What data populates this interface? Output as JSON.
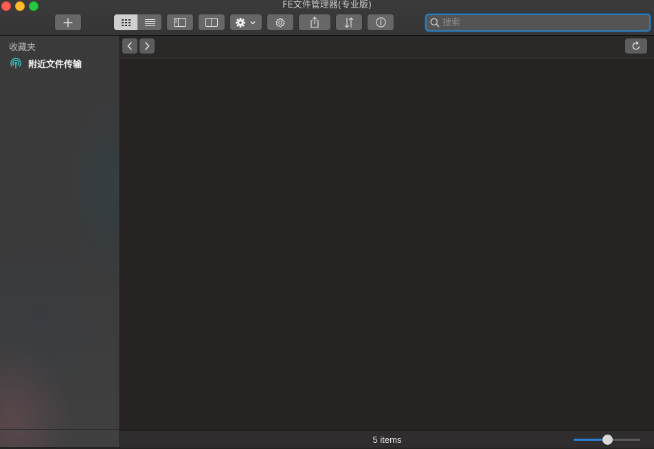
{
  "window": {
    "title": "FE文件管理器(专业版)"
  },
  "toolbar": {
    "add_icon": "plus-icon",
    "view_icons": [
      "grid-view-icon",
      "list-view-icon"
    ],
    "sidebar_toggle_icon": "sidebar-toggle-icon",
    "split_view_icon": "split-view-icon",
    "action_icon": "gear-dropdown-icon",
    "settings_icon": "settings-icon",
    "share_icon": "share-icon",
    "sort_icon": "sort-icon",
    "info_icon": "info-icon"
  },
  "search": {
    "placeholder": "搜索",
    "value": ""
  },
  "sidebar": {
    "section_title": "收藏夹",
    "items": [
      {
        "label": "附近文件传输",
        "icon": "airdrop-icon"
      }
    ]
  },
  "pathbar": {
    "back_icon": "chevron-left-icon",
    "forward_icon": "chevron-right-icon",
    "refresh_icon": "refresh-icon"
  },
  "status": {
    "items_text": "5 items",
    "zoom_fraction": 0.5
  },
  "colors": {
    "accent": "#2d7fd8",
    "airdrop": "#36c3c6"
  }
}
